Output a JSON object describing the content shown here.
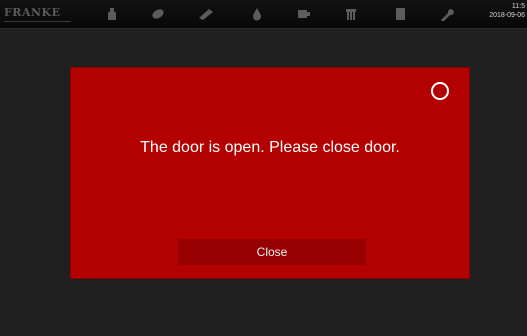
{
  "topbar": {
    "logo_text": "FRANKE",
    "icons": [
      {
        "name": "bottle-icon"
      },
      {
        "name": "bean-icon"
      },
      {
        "name": "cleaning-brush-icon"
      },
      {
        "name": "water-drop-icon"
      },
      {
        "name": "grinder-icon"
      },
      {
        "name": "milk-system-icon"
      },
      {
        "name": "document-icon"
      },
      {
        "name": "wrench-icon"
      }
    ],
    "time": "11:5",
    "date": "2018-09-06"
  },
  "dialog": {
    "message": "The door is open. Please close door.",
    "button_label": "Close",
    "color": "#b30000"
  }
}
